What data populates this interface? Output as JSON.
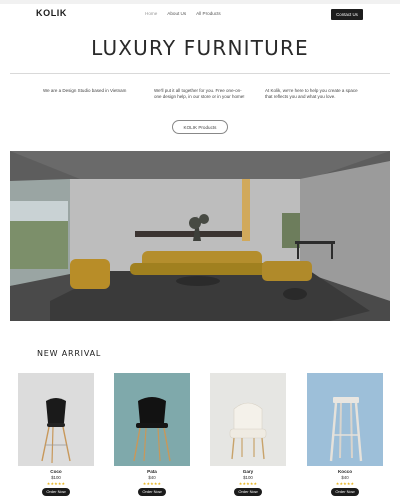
{
  "header": {
    "logo": "KOLIK",
    "nav": [
      "Home",
      "About Us",
      "All Products"
    ],
    "contact_label": "Contact Us"
  },
  "hero": {
    "title": "LUXURY FURNITURE",
    "col1": "We are a Design Studio based in Vietnam",
    "col2": "We'll put it all together for you. Free one-on-one design help, in our store or in your home!",
    "col3": "At Kolik, we're here to help you create a space that reflects you and what you love.",
    "products_button": "KOLIK Products"
  },
  "new_arrival": {
    "title": "NEW ARRIVAL",
    "order_label": "Order Now",
    "products": [
      {
        "name": "Coco",
        "price": "$100",
        "bg": "#dcdcdc"
      },
      {
        "name": "Pata",
        "price": "$40",
        "bg": "#7fa9ab"
      },
      {
        "name": "Gary",
        "price": "$100",
        "bg": "#e6e6e3"
      },
      {
        "name": "Kocco",
        "price": "$40",
        "bg": "#9dbfd9"
      }
    ]
  },
  "icons": {
    "stars": "star-rating-icon"
  },
  "colors": {
    "primary": "#1d1d1d",
    "accent_star": "#e7b422"
  }
}
